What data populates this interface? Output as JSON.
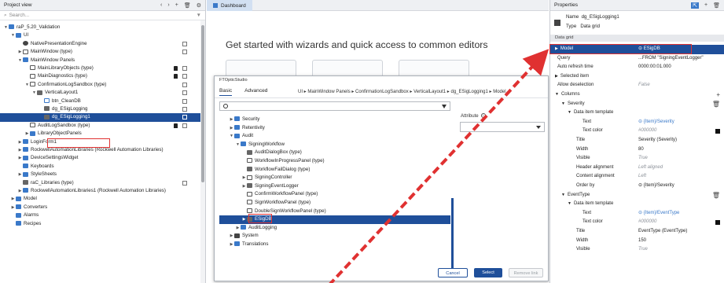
{
  "project_view": {
    "title": "Project view",
    "search_placeholder": "Search...",
    "toolbar": [
      "‹",
      "›",
      "+",
      "🗑",
      "⚙"
    ],
    "rows": [
      {
        "label": "raP_5.20_Validation",
        "indent": 0,
        "arrow": "▼",
        "icon": "folder"
      },
      {
        "label": "UI",
        "indent": 1,
        "arrow": "▼",
        "icon": "folder"
      },
      {
        "label": "NativePresentationEngine",
        "indent": 2,
        "arrow": "",
        "icon": "gear"
      },
      {
        "label": "MainWindow (type)",
        "indent": 2,
        "arrow": "▶",
        "icon": "win"
      },
      {
        "label": "MainWindow Panels",
        "indent": 2,
        "arrow": "▼",
        "icon": "folder"
      },
      {
        "label": "MainLibraryObjects (type)",
        "indent": 3,
        "arrow": "",
        "icon": "win",
        "lock": true
      },
      {
        "label": "MainDiagnostics (type)",
        "indent": 3,
        "arrow": "",
        "icon": "win",
        "lock": true
      },
      {
        "label": "ConfirmationLogSandbox (type)",
        "indent": 3,
        "arrow": "▼",
        "icon": "win"
      },
      {
        "label": "VerticalLayout1",
        "indent": 4,
        "arrow": "▼",
        "icon": "grid"
      },
      {
        "label": "btn_CleanDB",
        "indent": 5,
        "arrow": "",
        "icon": "btn"
      },
      {
        "label": "dg_ESigLogging",
        "indent": 5,
        "arrow": "",
        "icon": "grid"
      },
      {
        "label": "dg_ESigLogging1",
        "indent": 5,
        "arrow": "",
        "icon": "grid",
        "selected": true
      },
      {
        "label": "AuditLogSandbox (type)",
        "indent": 3,
        "arrow": "",
        "icon": "win",
        "lock": true
      },
      {
        "label": "LibraryObjectPanels",
        "indent": 3,
        "arrow": "▶",
        "icon": "folder"
      },
      {
        "label": "LoginForm1",
        "indent": 2,
        "arrow": "▶",
        "icon": "folder"
      },
      {
        "label": "RockwellAutomationLibraries (Rockwell Automation Libraries)",
        "indent": 2,
        "arrow": "▶",
        "icon": "folder"
      },
      {
        "label": "DeviceSettingsWidget",
        "indent": 2,
        "arrow": "▶",
        "icon": "folder"
      },
      {
        "label": "Keyboards",
        "indent": 2,
        "arrow": "",
        "icon": "folder"
      },
      {
        "label": "StyleSheets",
        "indent": 2,
        "arrow": "▶",
        "icon": "folder"
      },
      {
        "label": "raC_Libraries (type)",
        "indent": 2,
        "arrow": "",
        "icon": "grid"
      },
      {
        "label": "RockwellAutomationLibraries1 (Rockwell Automation Libraries)",
        "indent": 2,
        "arrow": "▶",
        "icon": "folder"
      },
      {
        "label": "Model",
        "indent": 1,
        "arrow": "▶",
        "icon": "folder"
      },
      {
        "label": "Converters",
        "indent": 1,
        "arrow": "▶",
        "icon": "folder"
      },
      {
        "label": "Alarms",
        "indent": 1,
        "arrow": "",
        "icon": "folder"
      },
      {
        "label": "Recipes",
        "indent": 1,
        "arrow": "",
        "icon": "folder"
      }
    ]
  },
  "dashboard": {
    "tab_label": "Dashboard",
    "heading": "Get started with wizards and quick access to common editors"
  },
  "dialog": {
    "title": "FTOpticStudio",
    "tabs": [
      {
        "label": "Basic",
        "active": true
      },
      {
        "label": "Advanced",
        "active": false
      }
    ],
    "breadcrumb": "UI  ▸  MainWindow Panels  ▸  ConfirmationLogSandbox  ▸  VerticalLayout1  ▸  dg_ESigLogging1  ▸  Model",
    "attribute_label": "Attribute",
    "attribute_info": "i",
    "tree": [
      {
        "label": "Security",
        "indent": 1,
        "arrow": "▶",
        "icon": "folder"
      },
      {
        "label": "Retentivity",
        "indent": 1,
        "arrow": "▶",
        "icon": "folder"
      },
      {
        "label": "Audit",
        "indent": 1,
        "arrow": "▼",
        "icon": "folder"
      },
      {
        "label": "SigningWorkflow",
        "indent": 2,
        "arrow": "▼",
        "icon": "folder"
      },
      {
        "label": "AuditDialogBox (type)",
        "indent": 3,
        "arrow": "",
        "icon": "grid"
      },
      {
        "label": "WorkflowInProgressPanel (type)",
        "indent": 3,
        "arrow": "",
        "icon": "win"
      },
      {
        "label": "WorkflowFailDialog (type)",
        "indent": 3,
        "arrow": "",
        "icon": "grid"
      },
      {
        "label": "SigningController",
        "indent": 3,
        "arrow": "▶",
        "icon": "win"
      },
      {
        "label": "SigningEventLogger",
        "indent": 3,
        "arrow": "▶",
        "icon": "grid"
      },
      {
        "label": "ConfirmWorkflowPanel (type)",
        "indent": 3,
        "arrow": "",
        "icon": "win"
      },
      {
        "label": "SignWorkflowPanel (type)",
        "indent": 3,
        "arrow": "",
        "icon": "win"
      },
      {
        "label": "DoubleSignWorkflowPanel (type)",
        "indent": 3,
        "arrow": "",
        "icon": "win"
      },
      {
        "label": "ESigDB",
        "indent": 3,
        "arrow": "▶",
        "icon": "grid",
        "selected": true
      },
      {
        "label": "AuditLogging",
        "indent": 2,
        "arrow": "▶",
        "icon": "folder"
      },
      {
        "label": "System",
        "indent": 1,
        "arrow": "▶",
        "icon": "gear"
      },
      {
        "label": "Translations",
        "indent": 1,
        "arrow": "▶",
        "icon": "folder"
      }
    ],
    "buttons": {
      "cancel": "Cancel",
      "select": "Select",
      "remove": "Remove link"
    }
  },
  "properties": {
    "title": "Properties",
    "name_label": "Name",
    "name_value": "dg_ESigLogging1",
    "type_label": "Type",
    "type_value": "Data grid",
    "group_label": "Data grid",
    "rows": [
      {
        "key": "Model",
        "value": "⊝ ESigDB",
        "indent": 0,
        "arrow": "▶",
        "selected": true
      },
      {
        "key": "Query",
        "value": "...FROM \"SigningEventLogger\"",
        "indent": 0
      },
      {
        "key": "Auto refresh time",
        "value": "0000:00:01.000",
        "indent": 0
      },
      {
        "key": "Selected item",
        "value": "",
        "indent": 0,
        "arrow": "▶"
      },
      {
        "key": "Allow deselection",
        "value": "False",
        "indent": 0,
        "muted": true
      },
      {
        "key": "Columns",
        "value": "",
        "indent": 0,
        "arrow": "▼",
        "ctl": "+"
      },
      {
        "key": "Severity",
        "value": "",
        "indent": 1,
        "arrow": "▼",
        "ctl": "🗑"
      },
      {
        "key": "Data item template",
        "value": "",
        "indent": 2,
        "arrow": "▼"
      },
      {
        "key": "Text",
        "value": "⊝ {Item}/Severity",
        "indent": 4,
        "link": true
      },
      {
        "key": "Text color",
        "value": "#000000",
        "indent": 4,
        "muted": true,
        "swatch": "#111111"
      },
      {
        "key": "Title",
        "value": "Severity (Severity)",
        "indent": 3
      },
      {
        "key": "Width",
        "value": "80",
        "indent": 3
      },
      {
        "key": "Visible",
        "value": "True",
        "indent": 3,
        "muted": true
      },
      {
        "key": "Header alignment",
        "value": "Left aligned",
        "indent": 3,
        "muted": true
      },
      {
        "key": "Content alignment",
        "value": "Left",
        "indent": 3,
        "muted": true
      },
      {
        "key": "Order by",
        "value": "⊝ {Item}/Severity",
        "indent": 3
      },
      {
        "key": "EventType",
        "value": "",
        "indent": 1,
        "arrow": "▼",
        "ctl": "🗑"
      },
      {
        "key": "Data item template",
        "value": "",
        "indent": 2,
        "arrow": "▼"
      },
      {
        "key": "Text",
        "value": "⊝ {Item}/EventType",
        "indent": 4,
        "link": true
      },
      {
        "key": "Text color",
        "value": "#000000",
        "indent": 4,
        "muted": true,
        "swatch": "#111111"
      },
      {
        "key": "Title",
        "value": "EventType (EventType)",
        "indent": 3
      },
      {
        "key": "Width",
        "value": "150",
        "indent": 3
      },
      {
        "key": "Visible",
        "value": "True",
        "indent": 3,
        "muted": true
      }
    ]
  },
  "colors": {
    "accent": "#1f4f9a",
    "highlight": "#e03131",
    "link": "#3a79c9"
  }
}
